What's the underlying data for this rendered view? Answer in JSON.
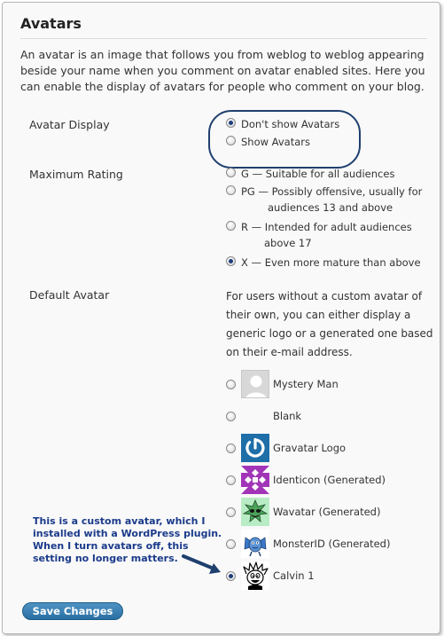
{
  "section": {
    "title": "Avatars",
    "intro": "An avatar is an image that follows you from weblog to weblog appearing beside your name when you comment on avatar enabled sites. Here you can enable the display of avatars for people who comment on your blog."
  },
  "avatar_display": {
    "label": "Avatar Display",
    "options": [
      {
        "label": "Don't show Avatars",
        "selected": true
      },
      {
        "label": "Show Avatars",
        "selected": false
      }
    ]
  },
  "max_rating": {
    "label": "Maximum Rating",
    "options": [
      {
        "line1": "G — Suitable for all audiences",
        "line2": "",
        "selected": false
      },
      {
        "line1": "PG — Possibly offensive, usually for",
        "line2": "audiences 13 and above",
        "selected": false
      },
      {
        "line1": "R — Intended for adult audiences",
        "line2": "above 17",
        "selected": false
      },
      {
        "line1": "X — Even more mature than above",
        "line2": "",
        "selected": true
      }
    ]
  },
  "default_avatar": {
    "label": "Default Avatar",
    "description": "For users without a custom avatar of their own, you can either display a generic logo or a generated one based on their e-mail address.",
    "options": [
      {
        "label": "Mystery Man",
        "icon": "mystery-man-icon",
        "selected": false
      },
      {
        "label": "Blank",
        "icon": "blank-icon",
        "selected": false
      },
      {
        "label": "Gravatar Logo",
        "icon": "gravatar-logo-icon",
        "selected": false
      },
      {
        "label": "Identicon (Generated)",
        "icon": "identicon-icon",
        "selected": false
      },
      {
        "label": "Wavatar (Generated)",
        "icon": "wavatar-icon",
        "selected": false
      },
      {
        "label": "MonsterID (Generated)",
        "icon": "monsterid-icon",
        "selected": false
      },
      {
        "label": "Calvin 1",
        "icon": "calvin-icon",
        "selected": true
      }
    ]
  },
  "annotation": {
    "note": "This is a custom avatar, which I installed with a WordPress plugin. When I turn avatars off, this setting no longer matters."
  },
  "actions": {
    "save_label": "Save Changes"
  },
  "colors": {
    "accent": "#2a6fa3",
    "annotation": "#1a3a8a",
    "highlight_ring": "#1f3f6e"
  }
}
